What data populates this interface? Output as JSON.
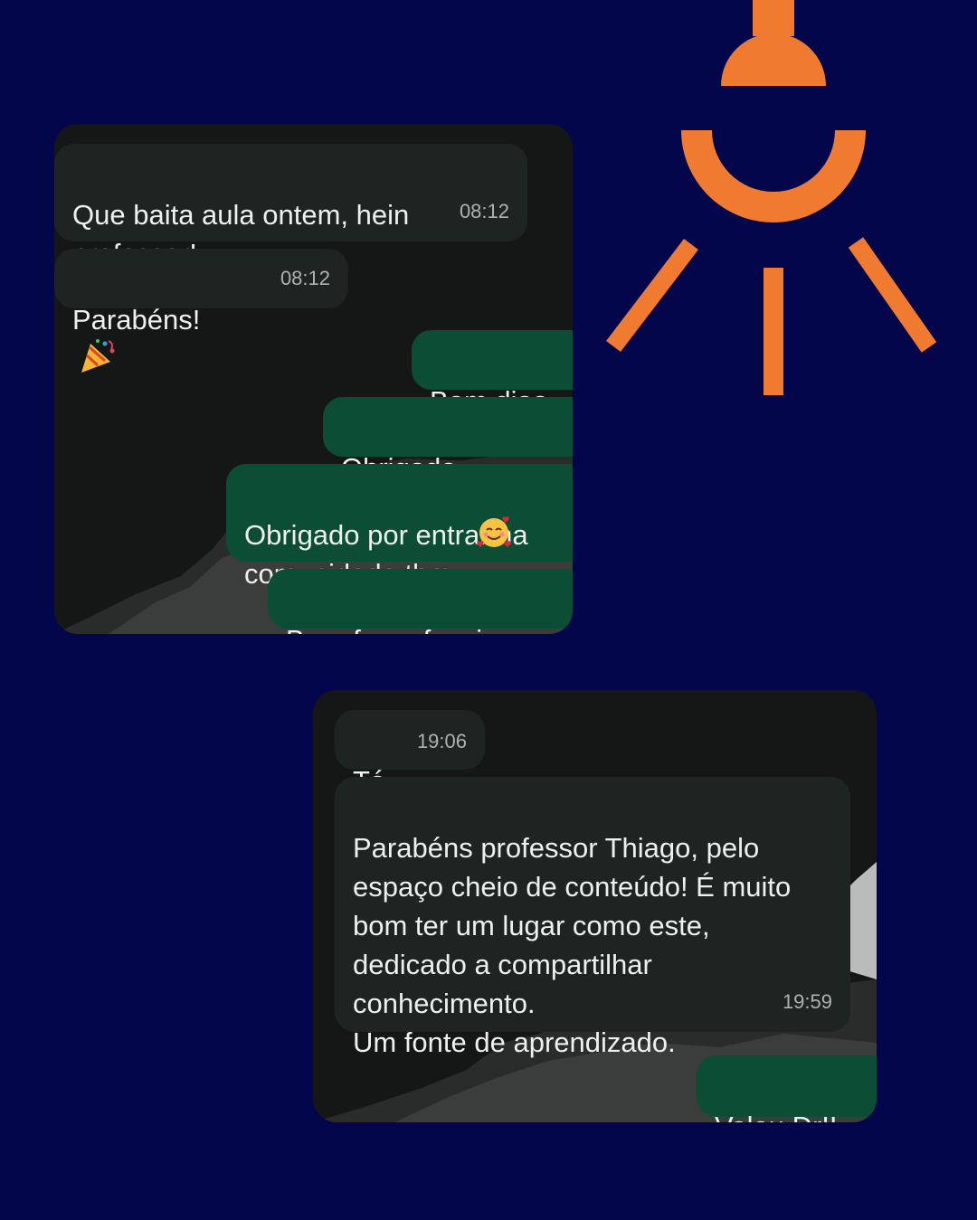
{
  "chat1": {
    "messages": [
      {
        "text": "Que baita aula ontem, hein\nprofessor!",
        "time": "08:12"
      },
      {
        "text": "Parabéns!",
        "time": "08:12"
      },
      {
        "text": "Bom diaa"
      },
      {
        "text": "Obrigado"
      },
      {
        "text": "Obrigado por entrar na\ncomunidade tbm"
      },
      {
        "text": "Bora fazer funcionar"
      }
    ]
  },
  "chat2": {
    "messages": [
      {
        "text": "Tá",
        "time": "19:06"
      },
      {
        "text": "Parabéns professor Thiago, pelo\nespaço cheio de conteúdo! É muito\nbom ter um lugar como este,\ndedicado a compartilhar\nconhecimento.\nUm fonte de aprendizado.",
        "time": "19:59"
      },
      {
        "text": "Valeu Dr!!"
      }
    ]
  },
  "colors": {
    "background": "#03064a",
    "accent": "#f07a2f",
    "incoming": "#1e2422",
    "outgoing": "#0b4d35"
  },
  "icons": [
    "lightbulb-icon",
    "party-popper-emoji",
    "heart-eyes-emoji",
    "smiling-hearts-emoji"
  ]
}
